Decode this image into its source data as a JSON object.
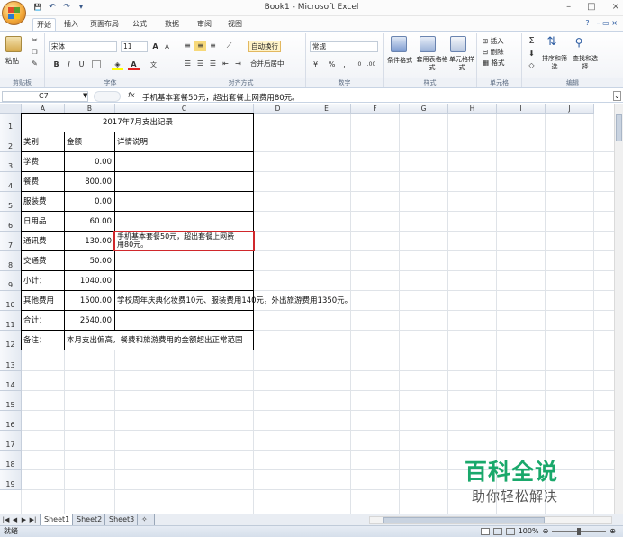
{
  "window": {
    "title": "Book1 - Microsoft Excel",
    "controls": {
      "minimize": "–",
      "maximize": "□",
      "close": "×"
    }
  },
  "qat": {
    "save": "💾",
    "undo": "↶",
    "redo": "↷",
    "more": "▾"
  },
  "ribbon_tabs": [
    "开始",
    "插入",
    "页面布局",
    "公式",
    "数据",
    "审阅",
    "视图"
  ],
  "ribbon_tab_right": {
    "help": "?",
    "extra": "– ▭ ×"
  },
  "ribbon": {
    "clipboard": {
      "paste": "粘贴",
      "label": "剪贴板"
    },
    "font": {
      "name": "宋体",
      "size": "11",
      "grow": "A",
      "shrink": "A",
      "bold": "B",
      "italic": "I",
      "underline": "U",
      "label": "字体"
    },
    "alignment": {
      "wrap": "自动换行",
      "merge": "合并后居中",
      "label": "对齐方式"
    },
    "number": {
      "format": "常规",
      "percent": "%",
      "comma": ",",
      "label": "数字"
    },
    "styles": {
      "cond": "条件格式",
      "table": "套用表格格式",
      "cell": "单元格样式",
      "label": "样式"
    },
    "cells": {
      "insert": "插入",
      "delete": "删除",
      "format": "格式",
      "label": "单元格"
    },
    "editing": {
      "sum": "Σ",
      "sort": "排序和筛选",
      "find": "查找和选择",
      "label": "编辑"
    }
  },
  "formula_bar": {
    "cell_ref": "C7",
    "fx": "fx",
    "content": "手机基本套餐50元，超出套餐上网费用80元。"
  },
  "columns": [
    "A",
    "B",
    "C",
    "D",
    "E",
    "F",
    "G",
    "H",
    "I",
    "J"
  ],
  "rows": [
    "1",
    "2",
    "3",
    "4",
    "5",
    "6",
    "7",
    "8",
    "9",
    "10",
    "11",
    "12",
    "13",
    "14",
    "15",
    "16",
    "17",
    "18",
    "19"
  ],
  "sheet": {
    "title": "2017年7月支出记录",
    "headers": {
      "a": "类别",
      "b": "金额",
      "c": "详情说明"
    },
    "data": [
      {
        "a": "学费",
        "b": "0.00",
        "c": ""
      },
      {
        "a": "餐费",
        "b": "800.00",
        "c": ""
      },
      {
        "a": "服装费",
        "b": "0.00",
        "c": ""
      },
      {
        "a": "日用品",
        "b": "60.00",
        "c": ""
      },
      {
        "a": "通讯费",
        "b": "130.00",
        "c1": "手机基本套餐50元，超出套餐上网费",
        "c2": "用80元。"
      },
      {
        "a": "交通费",
        "b": "50.00",
        "c": ""
      },
      {
        "a": "小计：",
        "b": "1040.00",
        "c": ""
      },
      {
        "a": "其他费用",
        "b": "1500.00",
        "c": "学校周年庆典化妆费10元、服装费用140元，外出旅游费用1350元。"
      },
      {
        "a": "合计：",
        "b": "2540.00",
        "c": ""
      },
      {
        "a": "备注：",
        "b": "",
        "c": "本月支出偏高，餐费和旅游费用的金额超出正常范围"
      }
    ]
  },
  "sheet_tabs": [
    "Sheet1",
    "Sheet2",
    "Sheet3"
  ],
  "status": {
    "ready": "就绪",
    "zoom": "100%"
  },
  "watermark": {
    "big": "百科全说",
    "small": "助你轻松解决"
  }
}
